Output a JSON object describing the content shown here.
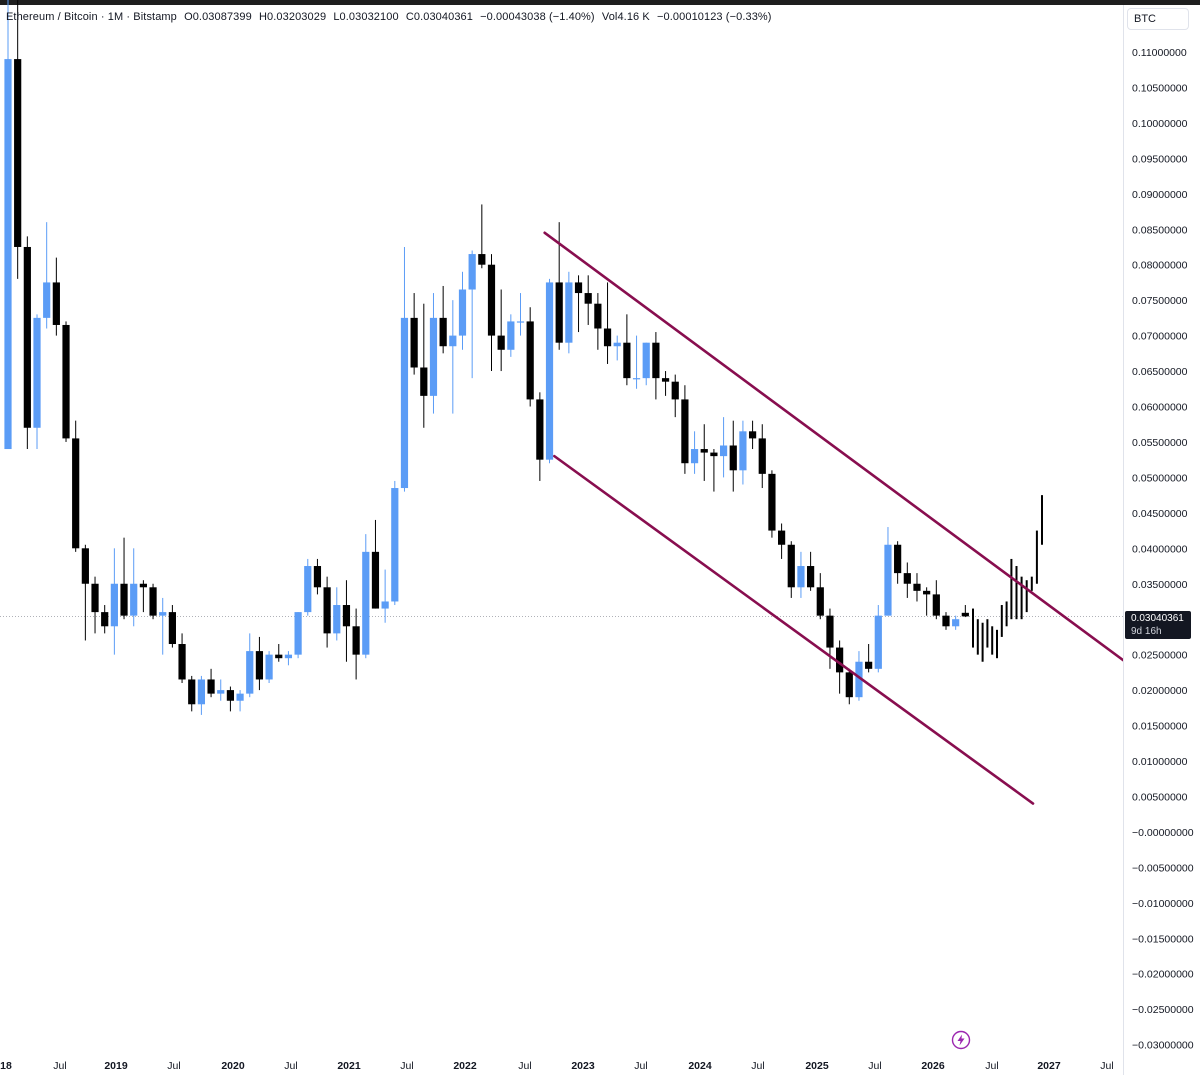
{
  "legend": {
    "symbol": "Ethereum / Bitcoin · 1M · Bitstamp",
    "open": "O0.03087399",
    "high": "H0.03203029",
    "low": "L0.03032100",
    "close": "C0.03040361",
    "change": "−0.00043038 (−1.40%)",
    "volume": "Vol4.16 K",
    "vol_change": "−0.00010123 (−0.33%)"
  },
  "currency": "BTC",
  "current_price": "0.03040361",
  "countdown": "9d 16h",
  "colors": {
    "up": "#5b9cf6",
    "down": "#000000",
    "channel": "#880e4f",
    "grid": "#ffffff"
  },
  "icons": {
    "bolt": "bolt-icon"
  },
  "chart_data": {
    "type": "candlestick",
    "x_ticks": [
      "18",
      "Jul",
      "2019",
      "Jul",
      "2020",
      "Jul",
      "2021",
      "Jul",
      "2022",
      "Jul",
      "2023",
      "Jul",
      "2024",
      "Jul",
      "2025",
      "Jul",
      "2026",
      "Jul",
      "2027",
      "Jul"
    ],
    "y_ticks": [
      "0.11000000",
      "0.10500000",
      "0.10000000",
      "0.09500000",
      "0.09000000",
      "0.08500000",
      "0.08000000",
      "0.07500000",
      "0.07000000",
      "0.06500000",
      "0.06000000",
      "0.05500000",
      "0.05000000",
      "0.04500000",
      "0.04000000",
      "0.03500000",
      "0.03000000",
      "0.02500000",
      "0.02000000",
      "0.01500000",
      "0.01000000",
      "0.00500000",
      "−0.00000000",
      "−0.00500000",
      "−0.01000000",
      "−0.01500000",
      "−0.02000000",
      "−0.02500000",
      "−0.03000000"
    ],
    "ylim": [
      -0.03,
      0.11
    ],
    "candles": [
      {
        "o": 0.054,
        "h": 0.12,
        "l": 0.078,
        "c": 0.109
      },
      {
        "o": 0.109,
        "h": 0.118,
        "l": 0.078,
        "c": 0.0825
      },
      {
        "o": 0.0825,
        "h": 0.084,
        "l": 0.054,
        "c": 0.057
      },
      {
        "o": 0.057,
        "h": 0.073,
        "l": 0.054,
        "c": 0.0725
      },
      {
        "o": 0.0725,
        "h": 0.086,
        "l": 0.071,
        "c": 0.0775
      },
      {
        "o": 0.0775,
        "h": 0.081,
        "l": 0.07,
        "c": 0.0715
      },
      {
        "o": 0.0715,
        "h": 0.072,
        "l": 0.055,
        "c": 0.0555
      },
      {
        "o": 0.0555,
        "h": 0.058,
        "l": 0.0395,
        "c": 0.04
      },
      {
        "o": 0.04,
        "h": 0.0405,
        "l": 0.027,
        "c": 0.035
      },
      {
        "o": 0.035,
        "h": 0.036,
        "l": 0.028,
        "c": 0.031
      },
      {
        "o": 0.031,
        "h": 0.032,
        "l": 0.028,
        "c": 0.029
      },
      {
        "o": 0.029,
        "h": 0.04,
        "l": 0.025,
        "c": 0.035
      },
      {
        "o": 0.035,
        "h": 0.0415,
        "l": 0.03,
        "c": 0.0305
      },
      {
        "o": 0.0305,
        "h": 0.04,
        "l": 0.029,
        "c": 0.035
      },
      {
        "o": 0.035,
        "h": 0.0355,
        "l": 0.031,
        "c": 0.0345
      },
      {
        "o": 0.0345,
        "h": 0.035,
        "l": 0.03,
        "c": 0.0305
      },
      {
        "o": 0.0305,
        "h": 0.033,
        "l": 0.025,
        "c": 0.031
      },
      {
        "o": 0.031,
        "h": 0.032,
        "l": 0.026,
        "c": 0.0265
      },
      {
        "o": 0.0265,
        "h": 0.028,
        "l": 0.021,
        "c": 0.0215
      },
      {
        "o": 0.0215,
        "h": 0.022,
        "l": 0.017,
        "c": 0.018
      },
      {
        "o": 0.018,
        "h": 0.022,
        "l": 0.0165,
        "c": 0.0215
      },
      {
        "o": 0.0215,
        "h": 0.023,
        "l": 0.019,
        "c": 0.0195
      },
      {
        "o": 0.0195,
        "h": 0.0215,
        "l": 0.0185,
        "c": 0.02
      },
      {
        "o": 0.02,
        "h": 0.0205,
        "l": 0.017,
        "c": 0.0185
      },
      {
        "o": 0.0185,
        "h": 0.02,
        "l": 0.017,
        "c": 0.0195
      },
      {
        "o": 0.0195,
        "h": 0.028,
        "l": 0.019,
        "c": 0.0255
      },
      {
        "o": 0.0255,
        "h": 0.0275,
        "l": 0.02,
        "c": 0.0215
      },
      {
        "o": 0.0215,
        "h": 0.0255,
        "l": 0.021,
        "c": 0.025
      },
      {
        "o": 0.025,
        "h": 0.0265,
        "l": 0.024,
        "c": 0.0245
      },
      {
        "o": 0.0245,
        "h": 0.0255,
        "l": 0.0235,
        "c": 0.025
      },
      {
        "o": 0.025,
        "h": 0.031,
        "l": 0.0245,
        "c": 0.031
      },
      {
        "o": 0.031,
        "h": 0.0385,
        "l": 0.0305,
        "c": 0.0375
      },
      {
        "o": 0.0375,
        "h": 0.0385,
        "l": 0.0335,
        "c": 0.0345
      },
      {
        "o": 0.0345,
        "h": 0.036,
        "l": 0.026,
        "c": 0.028
      },
      {
        "o": 0.028,
        "h": 0.0345,
        "l": 0.027,
        "c": 0.032
      },
      {
        "o": 0.032,
        "h": 0.0355,
        "l": 0.024,
        "c": 0.029
      },
      {
        "o": 0.029,
        "h": 0.0315,
        "l": 0.0215,
        "c": 0.025
      },
      {
        "o": 0.025,
        "h": 0.042,
        "l": 0.0245,
        "c": 0.0395
      },
      {
        "o": 0.0395,
        "h": 0.044,
        "l": 0.0315,
        "c": 0.0315
      },
      {
        "o": 0.0315,
        "h": 0.037,
        "l": 0.0295,
        "c": 0.0325
      },
      {
        "o": 0.0325,
        "h": 0.0495,
        "l": 0.032,
        "c": 0.0485
      },
      {
        "o": 0.0485,
        "h": 0.0825,
        "l": 0.048,
        "c": 0.0725
      },
      {
        "o": 0.0725,
        "h": 0.076,
        "l": 0.0645,
        "c": 0.0655
      },
      {
        "o": 0.0655,
        "h": 0.0745,
        "l": 0.057,
        "c": 0.0615
      },
      {
        "o": 0.0615,
        "h": 0.076,
        "l": 0.059,
        "c": 0.0725
      },
      {
        "o": 0.0725,
        "h": 0.077,
        "l": 0.0675,
        "c": 0.0685
      },
      {
        "o": 0.0685,
        "h": 0.075,
        "l": 0.059,
        "c": 0.07
      },
      {
        "o": 0.07,
        "h": 0.079,
        "l": 0.068,
        "c": 0.0765
      },
      {
        "o": 0.0765,
        "h": 0.082,
        "l": 0.064,
        "c": 0.0815
      },
      {
        "o": 0.0815,
        "h": 0.0885,
        "l": 0.0795,
        "c": 0.08
      },
      {
        "o": 0.08,
        "h": 0.0815,
        "l": 0.065,
        "c": 0.07
      },
      {
        "o": 0.07,
        "h": 0.0765,
        "l": 0.065,
        "c": 0.068
      },
      {
        "o": 0.068,
        "h": 0.073,
        "l": 0.067,
        "c": 0.072
      },
      {
        "o": 0.072,
        "h": 0.076,
        "l": 0.07,
        "c": 0.072
      },
      {
        "o": 0.072,
        "h": 0.074,
        "l": 0.06,
        "c": 0.061
      },
      {
        "o": 0.061,
        "h": 0.062,
        "l": 0.0495,
        "c": 0.0525
      },
      {
        "o": 0.0525,
        "h": 0.078,
        "l": 0.052,
        "c": 0.0775
      },
      {
        "o": 0.0775,
        "h": 0.086,
        "l": 0.068,
        "c": 0.069
      },
      {
        "o": 0.069,
        "h": 0.079,
        "l": 0.0675,
        "c": 0.0775
      },
      {
        "o": 0.0775,
        "h": 0.0785,
        "l": 0.0705,
        "c": 0.076
      },
      {
        "o": 0.076,
        "h": 0.0785,
        "l": 0.0715,
        "c": 0.0745
      },
      {
        "o": 0.0745,
        "h": 0.076,
        "l": 0.068,
        "c": 0.071
      },
      {
        "o": 0.071,
        "h": 0.0775,
        "l": 0.066,
        "c": 0.0685
      },
      {
        "o": 0.0685,
        "h": 0.07,
        "l": 0.0665,
        "c": 0.069
      },
      {
        "o": 0.069,
        "h": 0.073,
        "l": 0.063,
        "c": 0.064
      },
      {
        "o": 0.064,
        "h": 0.07,
        "l": 0.0625,
        "c": 0.064
      },
      {
        "o": 0.064,
        "h": 0.069,
        "l": 0.063,
        "c": 0.069
      },
      {
        "o": 0.069,
        "h": 0.0705,
        "l": 0.061,
        "c": 0.064
      },
      {
        "o": 0.064,
        "h": 0.065,
        "l": 0.0615,
        "c": 0.0635
      },
      {
        "o": 0.0635,
        "h": 0.0645,
        "l": 0.0585,
        "c": 0.061
      },
      {
        "o": 0.061,
        "h": 0.063,
        "l": 0.0505,
        "c": 0.052
      },
      {
        "o": 0.052,
        "h": 0.0565,
        "l": 0.0505,
        "c": 0.054
      },
      {
        "o": 0.054,
        "h": 0.0575,
        "l": 0.0495,
        "c": 0.0535
      },
      {
        "o": 0.0535,
        "h": 0.054,
        "l": 0.048,
        "c": 0.053
      },
      {
        "o": 0.053,
        "h": 0.0585,
        "l": 0.05,
        "c": 0.0545
      },
      {
        "o": 0.0545,
        "h": 0.058,
        "l": 0.048,
        "c": 0.051
      },
      {
        "o": 0.051,
        "h": 0.058,
        "l": 0.049,
        "c": 0.0565
      },
      {
        "o": 0.0565,
        "h": 0.058,
        "l": 0.054,
        "c": 0.0555
      },
      {
        "o": 0.0555,
        "h": 0.0575,
        "l": 0.0485,
        "c": 0.0505
      },
      {
        "o": 0.0505,
        "h": 0.051,
        "l": 0.0415,
        "c": 0.0425
      },
      {
        "o": 0.0425,
        "h": 0.0435,
        "l": 0.0385,
        "c": 0.0405
      },
      {
        "o": 0.0405,
        "h": 0.041,
        "l": 0.033,
        "c": 0.0345
      },
      {
        "o": 0.0345,
        "h": 0.0395,
        "l": 0.033,
        "c": 0.0375
      },
      {
        "o": 0.0375,
        "h": 0.0395,
        "l": 0.034,
        "c": 0.0345
      },
      {
        "o": 0.0345,
        "h": 0.0365,
        "l": 0.03,
        "c": 0.0305
      },
      {
        "o": 0.0305,
        "h": 0.0315,
        "l": 0.023,
        "c": 0.026
      },
      {
        "o": 0.026,
        "h": 0.027,
        "l": 0.0195,
        "c": 0.0225
      },
      {
        "o": 0.0225,
        "h": 0.023,
        "l": 0.018,
        "c": 0.019
      },
      {
        "o": 0.019,
        "h": 0.0255,
        "l": 0.0185,
        "c": 0.024
      },
      {
        "o": 0.024,
        "h": 0.0265,
        "l": 0.0225,
        "c": 0.023
      },
      {
        "o": 0.023,
        "h": 0.032,
        "l": 0.0225,
        "c": 0.0305
      },
      {
        "o": 0.0305,
        "h": 0.043,
        "l": 0.0305,
        "c": 0.0405
      },
      {
        "o": 0.0405,
        "h": 0.041,
        "l": 0.035,
        "c": 0.0365
      },
      {
        "o": 0.0365,
        "h": 0.038,
        "l": 0.033,
        "c": 0.035
      },
      {
        "o": 0.035,
        "h": 0.0365,
        "l": 0.0325,
        "c": 0.034
      },
      {
        "o": 0.034,
        "h": 0.0345,
        "l": 0.0305,
        "c": 0.0335
      },
      {
        "o": 0.0335,
        "h": 0.0355,
        "l": 0.03,
        "c": 0.0305
      },
      {
        "o": 0.0305,
        "h": 0.031,
        "l": 0.0285,
        "c": 0.029
      },
      {
        "o": 0.029,
        "h": 0.0305,
        "l": 0.0285,
        "c": 0.03
      },
      {
        "o": 0.0309,
        "h": 0.032,
        "l": 0.0303,
        "c": 0.0304
      }
    ],
    "projection_bars": [
      {
        "h": 0.0315,
        "l": 0.026
      },
      {
        "h": 0.03,
        "l": 0.025
      },
      {
        "h": 0.0295,
        "l": 0.024
      },
      {
        "h": 0.03,
        "l": 0.026
      },
      {
        "h": 0.029,
        "l": 0.025
      },
      {
        "h": 0.0285,
        "l": 0.0245
      },
      {
        "h": 0.032,
        "l": 0.0275
      },
      {
        "h": 0.0325,
        "l": 0.029
      },
      {
        "h": 0.0385,
        "l": 0.03
      },
      {
        "h": 0.0375,
        "l": 0.03
      },
      {
        "h": 0.036,
        "l": 0.03
      },
      {
        "h": 0.0355,
        "l": 0.031
      },
      {
        "h": 0.036,
        "l": 0.034
      },
      {
        "h": 0.0425,
        "l": 0.035
      },
      {
        "h": 0.0475,
        "l": 0.0405
      }
    ],
    "channel": {
      "upper": [
        {
          "i": 55.5,
          "v": 0.0845
        },
        {
          "i": 121,
          "v": 0.0185
        }
      ],
      "lower": [
        {
          "i": 56.5,
          "v": 0.053
        },
        {
          "i": 106,
          "v": 0.004
        }
      ]
    }
  }
}
